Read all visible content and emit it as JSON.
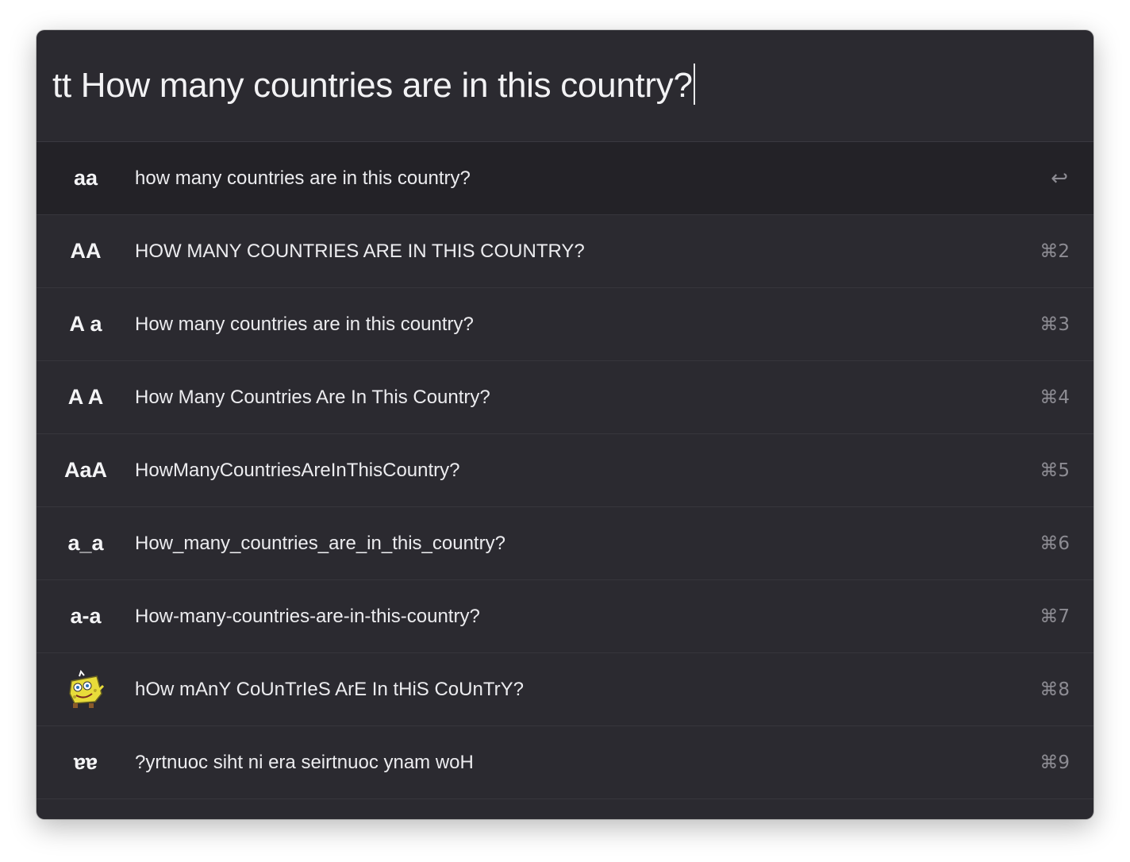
{
  "query": {
    "text": "tt How many countries are in this country?"
  },
  "results": [
    {
      "icon": "aa",
      "text": "how many countries are in this country?",
      "shortcut": "↩",
      "selected": true
    },
    {
      "icon": "AA",
      "text": "HOW MANY COUNTRIES ARE IN THIS COUNTRY?",
      "shortcut": "⌘2"
    },
    {
      "icon": "A a",
      "text": "How many countries are in this country?",
      "shortcut": "⌘3"
    },
    {
      "icon": "A A",
      "text": "How Many Countries Are In This Country?",
      "shortcut": "⌘4"
    },
    {
      "icon": "AaA",
      "text": "HowManyCountriesAreInThisCountry?",
      "shortcut": "⌘5"
    },
    {
      "icon": "a_a",
      "text": "How_many_countries_are_in_this_country?",
      "shortcut": "⌘6"
    },
    {
      "icon": "a-a",
      "text": "How-many-countries-are-in-this-country?",
      "shortcut": "⌘7"
    },
    {
      "icon": "mocking-spongebob-icon",
      "text": "hOw mAnY CoUnTrIeS ArE In tHiS CoUnTrY?",
      "shortcut": "⌘8"
    },
    {
      "icon": "ɐɐ",
      "text": "?yrtnuoc siht ni era seirtnuoc ynam woH",
      "shortcut": "⌘9"
    }
  ],
  "colors": {
    "window_bg": "#2b2a30",
    "selected_row_bg": "#232227",
    "text": "#ececef",
    "shortcut": "#8d8c93"
  }
}
